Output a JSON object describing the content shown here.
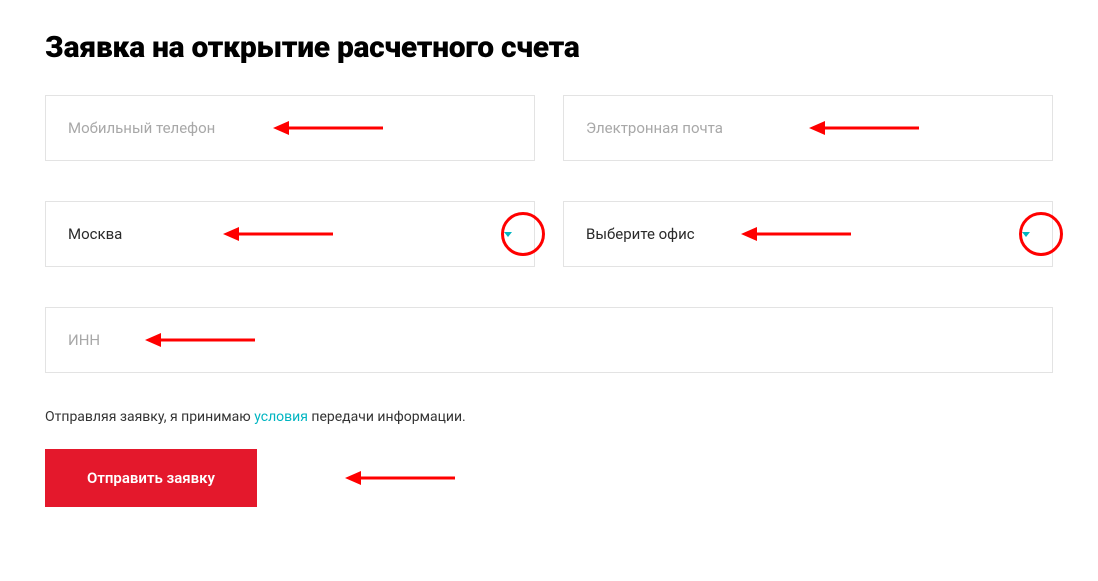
{
  "title": "Заявка на открытие расчетного счета",
  "fields": {
    "phone": {
      "placeholder": "Мобильный телефон",
      "value": ""
    },
    "email": {
      "placeholder": "Электронная почта",
      "value": ""
    },
    "city": {
      "selected": "Москва"
    },
    "office": {
      "selected": "Выберите офис"
    },
    "inn": {
      "placeholder": "ИНН",
      "value": ""
    }
  },
  "consent": {
    "prefix": "Отправляя заявку, я принимаю ",
    "link": "условия",
    "suffix": " передачи информации."
  },
  "submit": {
    "label": "Отправить заявку"
  },
  "annotation": {
    "color": "#ff0000"
  }
}
